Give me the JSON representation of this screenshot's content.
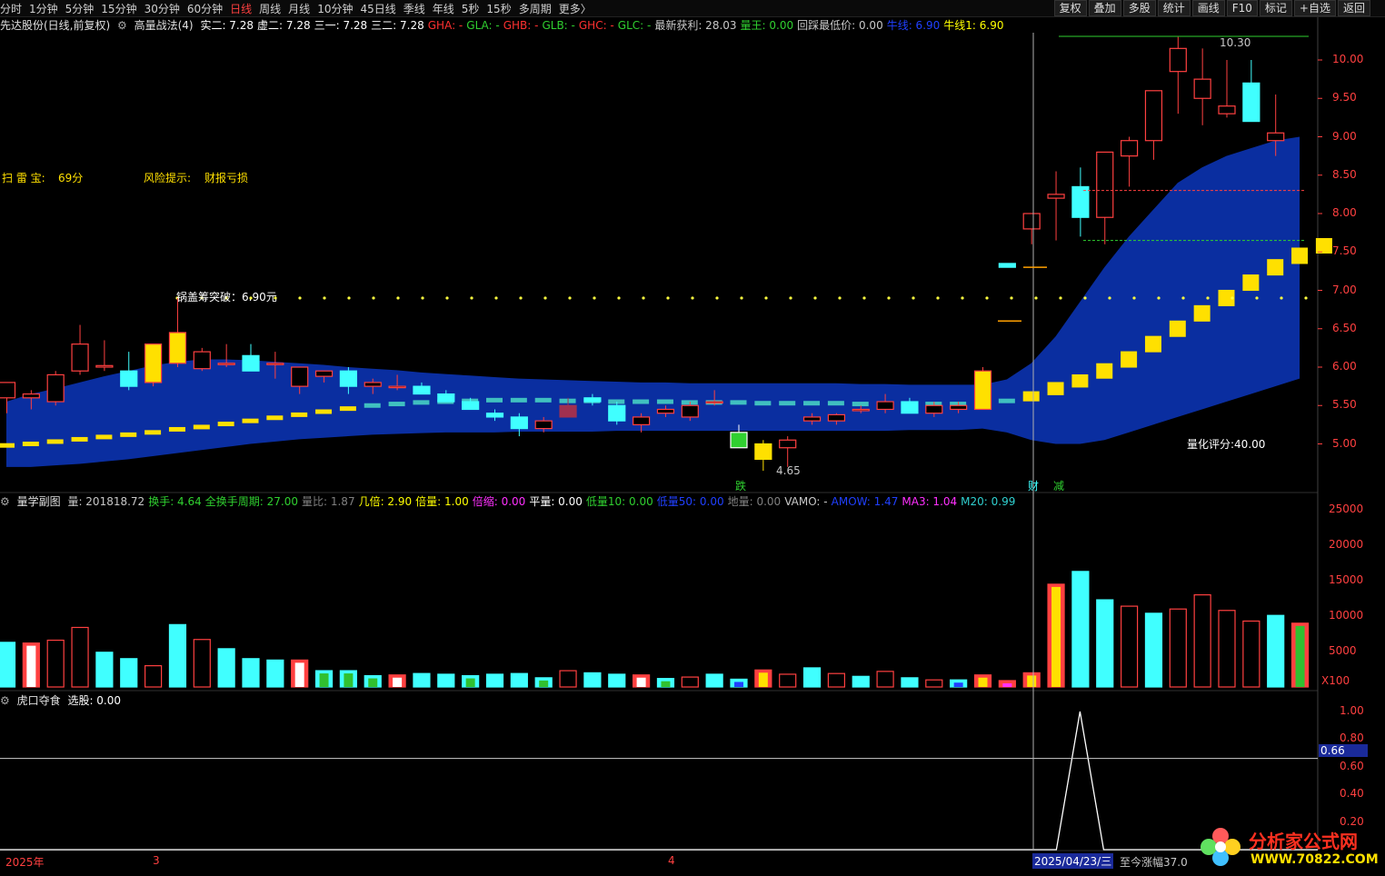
{
  "toolbar": {
    "periods": [
      "分时",
      "1分钟",
      "5分钟",
      "15分钟",
      "30分钟",
      "60分钟",
      "日线",
      "周线",
      "月线",
      "10分钟",
      "45日线",
      "季线",
      "年线",
      "5秒",
      "15秒",
      "多周期",
      "更多〉"
    ],
    "active_period": "日线",
    "right_buttons": [
      "复权",
      "叠加",
      "多股",
      "统计",
      "画线",
      "F10",
      "标记",
      "+自选",
      "返回"
    ]
  },
  "main_info": {
    "stock": "先达股份(日线,前复权)",
    "indicator": "高量战法(4)",
    "items": [
      {
        "t": "实二: 7.28",
        "c": "#ffffff"
      },
      {
        "t": "虚二: 7.28",
        "c": "#ffffff"
      },
      {
        "t": "三一: 7.28",
        "c": "#ffffff"
      },
      {
        "t": "三二: 7.28",
        "c": "#ffffff"
      },
      {
        "t": "GHA: -",
        "c": "#ff3030"
      },
      {
        "t": "GLA: -",
        "c": "#30d030"
      },
      {
        "t": "GHB: -",
        "c": "#ff3030"
      },
      {
        "t": "GLB: -",
        "c": "#30d030"
      },
      {
        "t": "GHC: -",
        "c": "#ff3030"
      },
      {
        "t": "GLC: -",
        "c": "#30d030"
      },
      {
        "t": "最新获利: 28.03",
        "c": "#c8c8c8"
      },
      {
        "t": "量王: 0.00",
        "c": "#30d030"
      },
      {
        "t": "回踩最低价: 0.00",
        "c": "#c8c8c8"
      },
      {
        "t": "牛线: 6.90",
        "c": "#2040ff"
      },
      {
        "t": "牛线1: 6.90",
        "c": "#ffff00"
      }
    ]
  },
  "labels": {
    "scan_label": "扫 雷 宝:",
    "scan_value": "69分",
    "risk_label": "风险提示:",
    "risk_value": "财报亏损",
    "breakout": "锅盖筹突破：6.90元",
    "quant_score": "量化评分:40.00",
    "high_price": "10.30",
    "low_price": "4.65",
    "signal_die": "跌",
    "signal_cai": "财",
    "signal_jian": "减"
  },
  "price_axis": [
    "10.00",
    "9.50",
    "9.00",
    "8.50",
    "8.00",
    "7.50",
    "7.00",
    "6.50",
    "6.00",
    "5.50",
    "5.00"
  ],
  "sub1_info": {
    "name": "量学副图",
    "items": [
      {
        "t": "量: 201818.72",
        "c": "#c8c8c8"
      },
      {
        "t": "换手: 4.64",
        "c": "#30d030"
      },
      {
        "t": "全换手周期: 27.00",
        "c": "#30d030"
      },
      {
        "t": "量比: 1.87",
        "c": "#808080"
      },
      {
        "t": "几倍: 2.90",
        "c": "#ffff00"
      },
      {
        "t": "倍量: 1.00",
        "c": "#ffff00"
      },
      {
        "t": "倍缩: 0.00",
        "c": "#ff30ff"
      },
      {
        "t": "平量: 0.00",
        "c": "#ffffff"
      },
      {
        "t": "低量10: 0.00",
        "c": "#30d030"
      },
      {
        "t": "低量50: 0.00",
        "c": "#2040ff"
      },
      {
        "t": "地量: 0.00",
        "c": "#808080"
      },
      {
        "t": "VAMO: -",
        "c": "#c8c8c8"
      },
      {
        "t": "AMOW: 1.47",
        "c": "#2040ff"
      },
      {
        "t": "MA3: 1.04",
        "c": "#ff30ff"
      },
      {
        "t": "M20: 0.99",
        "c": "#30d0d0"
      }
    ]
  },
  "vol_axis": [
    "25000",
    "20000",
    "15000",
    "10000",
    "5000"
  ],
  "vol_unit": "X100",
  "sub2_info": {
    "name": "虎口夺食",
    "items": [
      {
        "t": "选股: 0.00",
        "c": "#ffffff"
      }
    ]
  },
  "sub2_axis": [
    "1.00",
    "0.80",
    "0.60",
    "0.40",
    "0.20"
  ],
  "sub2_cursor": "0.66",
  "timebar": {
    "year": "2025年",
    "m3": "3",
    "m4": "4",
    "cursor_date": "2025/04/23/三",
    "cursor_info": "至今涨幅37.0"
  },
  "watermark": {
    "title": "分析家公式网",
    "url": "WWW.70822.COM"
  },
  "colors": {
    "up": "#ff4040",
    "down": "#40ffff",
    "band": "#0a2ea0",
    "bull": "#ffe000"
  },
  "chart_data": {
    "type": "candlestick",
    "candles": [
      {
        "o": 5.6,
        "h": 5.8,
        "l": 5.4,
        "c": 5.8
      },
      {
        "o": 5.6,
        "h": 5.7,
        "l": 5.45,
        "c": 5.65
      },
      {
        "o": 5.55,
        "h": 5.95,
        "l": 5.5,
        "c": 5.9
      },
      {
        "o": 5.95,
        "h": 6.55,
        "l": 5.9,
        "c": 6.3
      },
      {
        "o": 6.0,
        "h": 6.35,
        "l": 5.95,
        "c": 6.02
      },
      {
        "o": 5.95,
        "h": 6.2,
        "l": 5.7,
        "c": 5.75
      },
      {
        "o": 5.8,
        "h": 6.3,
        "l": 5.75,
        "c": 6.3
      },
      {
        "o": 6.05,
        "h": 6.9,
        "l": 6.0,
        "c": 6.45
      },
      {
        "o": 5.98,
        "h": 6.25,
        "l": 5.95,
        "c": 6.2
      },
      {
        "o": 6.05,
        "h": 6.3,
        "l": 6.0,
        "c": 6.05
      },
      {
        "o": 6.15,
        "h": 6.3,
        "l": 5.95,
        "c": 5.95
      },
      {
        "o": 6.05,
        "h": 6.2,
        "l": 5.85,
        "c": 6.05
      },
      {
        "o": 5.75,
        "h": 6.0,
        "l": 5.65,
        "c": 6.0
      },
      {
        "o": 5.88,
        "h": 5.95,
        "l": 5.8,
        "c": 5.95
      },
      {
        "o": 5.95,
        "h": 6.0,
        "l": 5.65,
        "c": 5.75
      },
      {
        "o": 5.75,
        "h": 5.85,
        "l": 5.65,
        "c": 5.8
      },
      {
        "o": 5.75,
        "h": 5.9,
        "l": 5.7,
        "c": 5.75
      },
      {
        "o": 5.75,
        "h": 5.8,
        "l": 5.65,
        "c": 5.65
      },
      {
        "o": 5.65,
        "h": 5.7,
        "l": 5.55,
        "c": 5.55
      },
      {
        "o": 5.55,
        "h": 5.6,
        "l": 5.45,
        "c": 5.45
      },
      {
        "o": 5.4,
        "h": 5.45,
        "l": 5.3,
        "c": 5.35
      },
      {
        "o": 5.35,
        "h": 5.4,
        "l": 5.1,
        "c": 5.2
      },
      {
        "o": 5.2,
        "h": 5.35,
        "l": 5.15,
        "c": 5.3
      },
      {
        "o": 5.5,
        "h": 5.6,
        "l": 5.35,
        "c": 5.35
      },
      {
        "o": 5.6,
        "h": 5.65,
        "l": 5.5,
        "c": 5.55
      },
      {
        "o": 5.5,
        "h": 5.55,
        "l": 5.25,
        "c": 5.3
      },
      {
        "o": 5.25,
        "h": 5.4,
        "l": 5.15,
        "c": 5.35
      },
      {
        "o": 5.4,
        "h": 5.5,
        "l": 5.35,
        "c": 5.45
      },
      {
        "o": 5.35,
        "h": 5.55,
        "l": 5.3,
        "c": 5.5
      },
      {
        "o": 5.55,
        "h": 5.7,
        "l": 5.5,
        "c": 5.55
      },
      {
        "o": 5.15,
        "h": 5.25,
        "l": 4.95,
        "c": 4.95
      },
      {
        "o": 5.0,
        "h": 5.05,
        "l": 4.65,
        "c": 4.8
      },
      {
        "o": 4.95,
        "h": 5.1,
        "l": 4.7,
        "c": 5.05
      },
      {
        "o": 5.3,
        "h": 5.4,
        "l": 5.25,
        "c": 5.35
      },
      {
        "o": 5.3,
        "h": 5.4,
        "l": 5.25,
        "c": 5.38
      },
      {
        "o": 5.45,
        "h": 5.5,
        "l": 5.4,
        "c": 5.45
      },
      {
        "o": 5.45,
        "h": 5.65,
        "l": 5.4,
        "c": 5.55
      },
      {
        "o": 5.55,
        "h": 5.6,
        "l": 5.4,
        "c": 5.4
      },
      {
        "o": 5.4,
        "h": 5.55,
        "l": 5.35,
        "c": 5.5
      },
      {
        "o": 5.45,
        "h": 5.55,
        "l": 5.4,
        "c": 5.5
      },
      {
        "o": 5.45,
        "h": 6.0,
        "l": 5.45,
        "c": 5.95
      },
      {
        "o": 7.35,
        "h": 7.35,
        "l": 7.3,
        "c": 7.3
      },
      {
        "o": 7.8,
        "h": 7.95,
        "l": 7.6,
        "c": 8.0
      },
      {
        "o": 8.2,
        "h": 8.55,
        "l": 7.65,
        "c": 8.25
      },
      {
        "o": 8.35,
        "h": 8.6,
        "l": 7.7,
        "c": 7.95
      },
      {
        "o": 7.95,
        "h": 8.8,
        "l": 7.6,
        "c": 8.8
      },
      {
        "o": 8.75,
        "h": 9.0,
        "l": 8.35,
        "c": 8.95
      },
      {
        "o": 8.95,
        "h": 9.6,
        "l": 8.7,
        "c": 9.6
      },
      {
        "o": 9.85,
        "h": 10.3,
        "l": 9.3,
        "c": 10.15
      },
      {
        "o": 9.5,
        "h": 10.15,
        "l": 9.15,
        "c": 9.75
      },
      {
        "o": 9.3,
        "h": 10.0,
        "l": 9.25,
        "c": 9.4
      },
      {
        "o": 9.7,
        "h": 10.0,
        "l": 9.2,
        "c": 9.2
      },
      {
        "o": 8.95,
        "h": 9.55,
        "l": 8.75,
        "c": 9.05
      }
    ],
    "bull_line": [
      4.98,
      5.0,
      5.03,
      5.06,
      5.09,
      5.12,
      5.15,
      5.19,
      5.22,
      5.26,
      5.3,
      5.34,
      5.38,
      5.42,
      5.46,
      5.5,
      5.52,
      5.54,
      5.55,
      5.56,
      5.57,
      5.57,
      5.57,
      5.56,
      5.56,
      5.55,
      5.55,
      5.55,
      5.54,
      5.54,
      5.54,
      5.53,
      5.53,
      5.53,
      5.53,
      5.52,
      5.52,
      5.52,
      5.52,
      5.52,
      5.52,
      5.56,
      5.62,
      5.72,
      5.82,
      5.95,
      6.1,
      6.3,
      6.5,
      6.7,
      6.9,
      7.1,
      7.3,
      7.45,
      7.58
    ],
    "band_upper": [
      5.55,
      5.65,
      5.72,
      5.8,
      5.88,
      5.95,
      6.02,
      6.07,
      6.1,
      6.1,
      6.09,
      6.07,
      6.05,
      6.03,
      6.0,
      5.98,
      5.96,
      5.93,
      5.91,
      5.89,
      5.87,
      5.85,
      5.84,
      5.83,
      5.82,
      5.81,
      5.8,
      5.8,
      5.79,
      5.79,
      5.79,
      5.79,
      5.79,
      5.79,
      5.79,
      5.78,
      5.78,
      5.77,
      5.77,
      5.77,
      5.77,
      5.84,
      6.05,
      6.4,
      6.85,
      7.3,
      7.7,
      8.05,
      8.4,
      8.6,
      8.75,
      8.85,
      8.95,
      9.0
    ],
    "band_lower": [
      4.7,
      4.7,
      4.72,
      4.74,
      4.77,
      4.8,
      4.84,
      4.88,
      4.92,
      4.96,
      5.0,
      5.03,
      5.06,
      5.08,
      5.1,
      5.12,
      5.13,
      5.14,
      5.15,
      5.15,
      5.15,
      5.16,
      5.16,
      5.16,
      5.16,
      5.17,
      5.17,
      5.17,
      5.17,
      5.17,
      5.17,
      5.17,
      5.17,
      5.17,
      5.17,
      5.17,
      5.17,
      5.18,
      5.18,
      5.18,
      5.2,
      5.15,
      5.05,
      5.0,
      5.0,
      5.05,
      5.15,
      5.25,
      5.35,
      5.45,
      5.55,
      5.65,
      5.75,
      5.85,
      5.95,
      6.05
    ],
    "breakout_level": 6.9,
    "volumes": [
      {
        "v": 6300,
        "s": "c"
      },
      {
        "v": 6200,
        "s": "w"
      },
      {
        "v": 6600,
        "s": "r"
      },
      {
        "v": 8400,
        "s": "r"
      },
      {
        "v": 4900,
        "s": "c"
      },
      {
        "v": 4000,
        "s": "c"
      },
      {
        "v": 3000,
        "s": "r"
      },
      {
        "v": 8800,
        "s": "c"
      },
      {
        "v": 6700,
        "s": "r"
      },
      {
        "v": 5400,
        "s": "c"
      },
      {
        "v": 4000,
        "s": "c"
      },
      {
        "v": 3800,
        "s": "c"
      },
      {
        "v": 3800,
        "s": "w"
      },
      {
        "v": 2300,
        "s": "g"
      },
      {
        "v": 2300,
        "s": "g"
      },
      {
        "v": 1600,
        "s": "g"
      },
      {
        "v": 1700,
        "s": "w"
      },
      {
        "v": 1900,
        "s": "c"
      },
      {
        "v": 1800,
        "s": "c"
      },
      {
        "v": 1600,
        "s": "g"
      },
      {
        "v": 1800,
        "s": "c"
      },
      {
        "v": 1900,
        "s": "c"
      },
      {
        "v": 1300,
        "s": "g"
      },
      {
        "v": 2300,
        "s": "r"
      },
      {
        "v": 2000,
        "s": "c"
      },
      {
        "v": 1800,
        "s": "c"
      },
      {
        "v": 1700,
        "s": "w"
      },
      {
        "v": 1200,
        "s": "g"
      },
      {
        "v": 1400,
        "s": "r"
      },
      {
        "v": 1800,
        "s": "c"
      },
      {
        "v": 1100,
        "s": "b"
      },
      {
        "v": 2400,
        "s": "y"
      },
      {
        "v": 1800,
        "s": "r"
      },
      {
        "v": 2700,
        "s": "c"
      },
      {
        "v": 1900,
        "s": "r"
      },
      {
        "v": 1500,
        "s": "c"
      },
      {
        "v": 2200,
        "s": "r"
      },
      {
        "v": 1300,
        "s": "c"
      },
      {
        "v": 1000,
        "s": "r"
      },
      {
        "v": 1000,
        "s": "b"
      },
      {
        "v": 1700,
        "s": "y"
      },
      {
        "v": 900,
        "s": "m"
      },
      {
        "v": 2000,
        "s": "y"
      },
      {
        "v": 14500,
        "s": "y"
      },
      {
        "v": 16300,
        "s": "c"
      },
      {
        "v": 12300,
        "s": "c"
      },
      {
        "v": 11400,
        "s": "r"
      },
      {
        "v": 10400,
        "s": "c"
      },
      {
        "v": 11000,
        "s": "r"
      },
      {
        "v": 13000,
        "s": "r"
      },
      {
        "v": 10800,
        "s": "r"
      },
      {
        "v": 9300,
        "s": "r"
      },
      {
        "v": 10100,
        "s": "c"
      },
      {
        "v": 9000,
        "s": "rg"
      }
    ],
    "xuangu": {
      "peak_index": 44,
      "peak_value": 1.0
    }
  }
}
